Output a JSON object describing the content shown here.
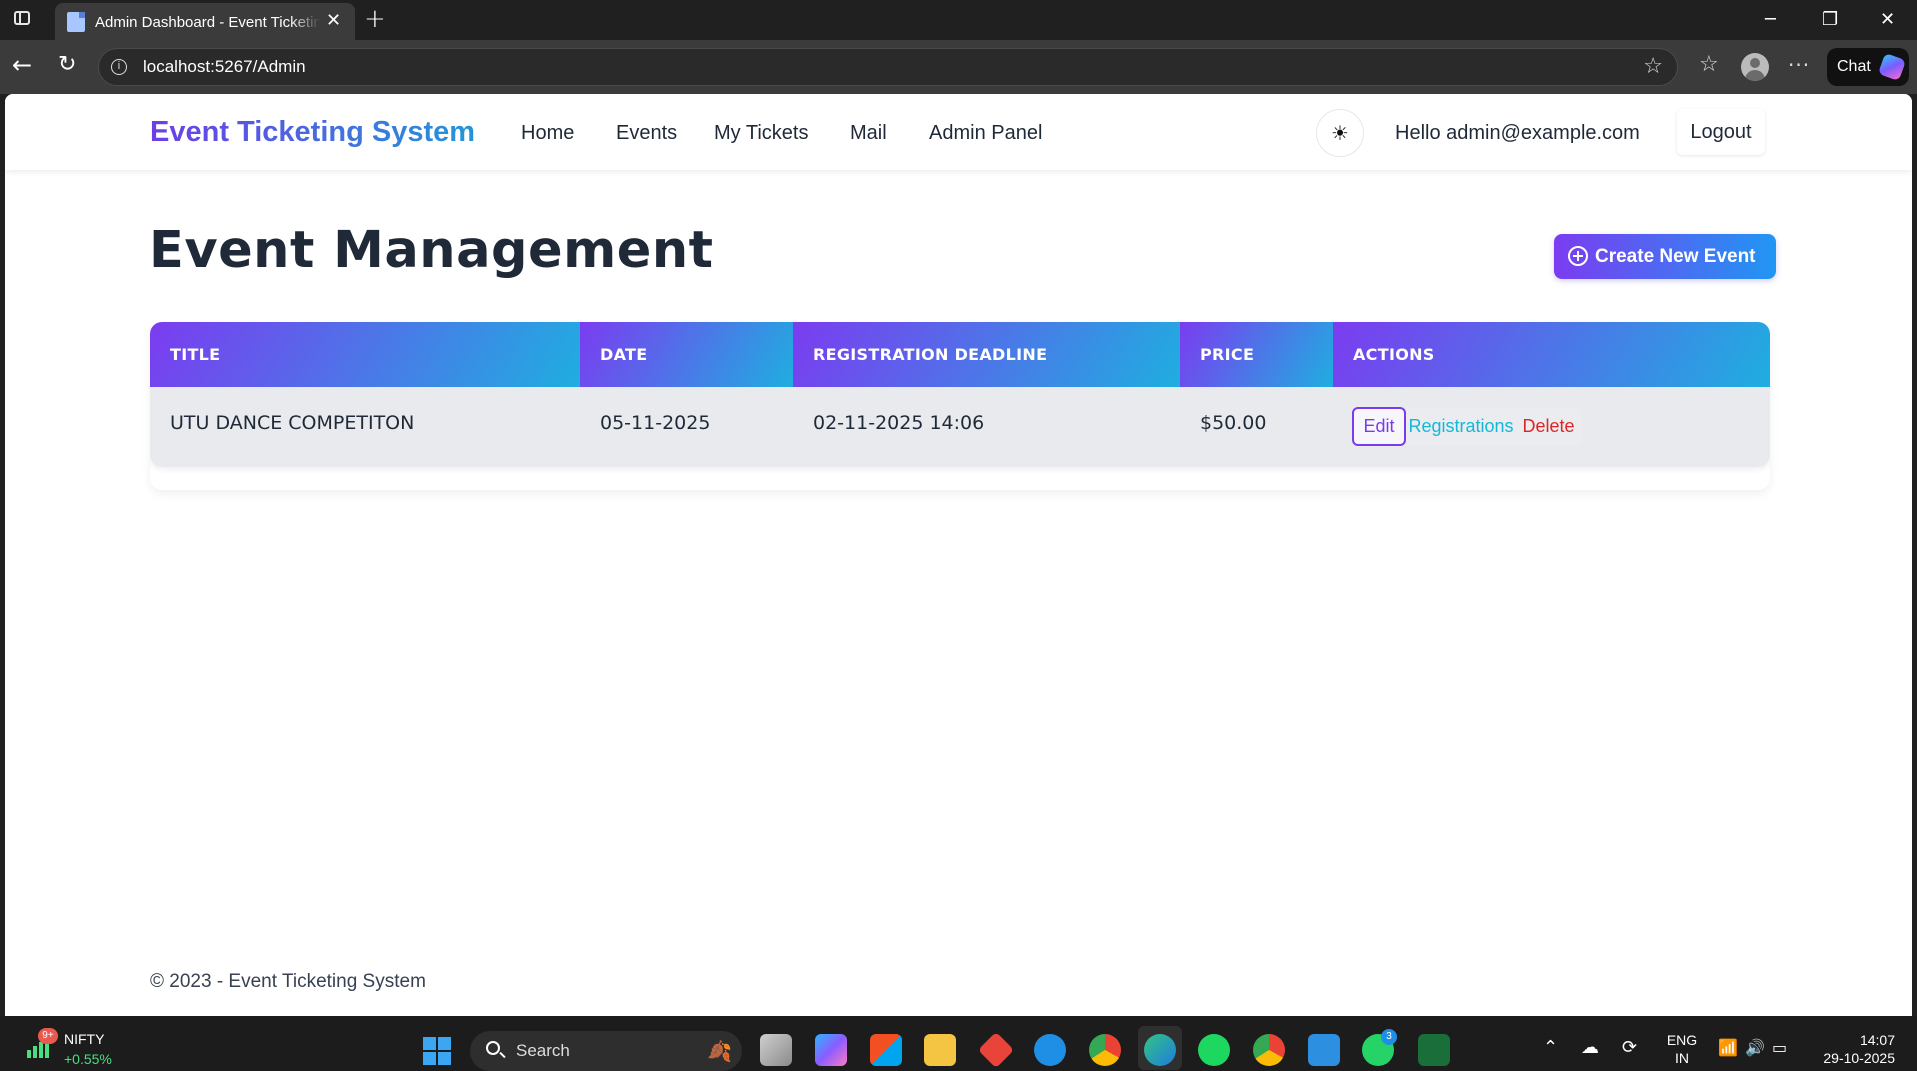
{
  "browser": {
    "tab_title": "Admin Dashboard - Event Ticketing System",
    "tab_close": "✕",
    "new_tab": "+",
    "url": "localhost:5267/Admin",
    "chat_label": "Chat",
    "window_controls": {
      "minimize": "─",
      "restore": "❐",
      "close": "✕"
    }
  },
  "navbar": {
    "brand": "Event Ticketing System",
    "links": [
      "Home",
      "Events",
      "My Tickets",
      "Mail",
      "Admin Panel"
    ],
    "theme_icon": "☀",
    "greeting": "Hello admin@example.com",
    "logout": "Logout"
  },
  "page": {
    "title": "Event Management",
    "create_button": "Create New Event"
  },
  "table": {
    "headers": [
      "TITLE",
      "DATE",
      "REGISTRATION DEADLINE",
      "PRICE",
      "ACTIONS"
    ],
    "rows": [
      {
        "title": "UTU DANCE COMPETITON",
        "date": "05-11-2025",
        "deadline": "02-11-2025 14:06",
        "price": "$50.00",
        "actions": {
          "edit": "Edit",
          "registrations": "Registrations",
          "delete": "Delete"
        }
      }
    ]
  },
  "footer": {
    "text": "© 2023 - Event Ticketing System"
  },
  "taskbar": {
    "nifty_badge": "9+",
    "nifty_label": "NIFTY",
    "nifty_change": "+0.55%",
    "search_label": "Search",
    "whatsapp_badge": "3",
    "language": "ENG",
    "region": "IN",
    "time": "14:07",
    "date": "29-10-2025"
  },
  "colors": {
    "brand_start": "#6d3ee6",
    "brand_end": "#2395d8",
    "edit": "#7c3aed",
    "registrations": "#14b8d6",
    "delete": "#dc2626",
    "nifty_up": "#4ade80"
  }
}
